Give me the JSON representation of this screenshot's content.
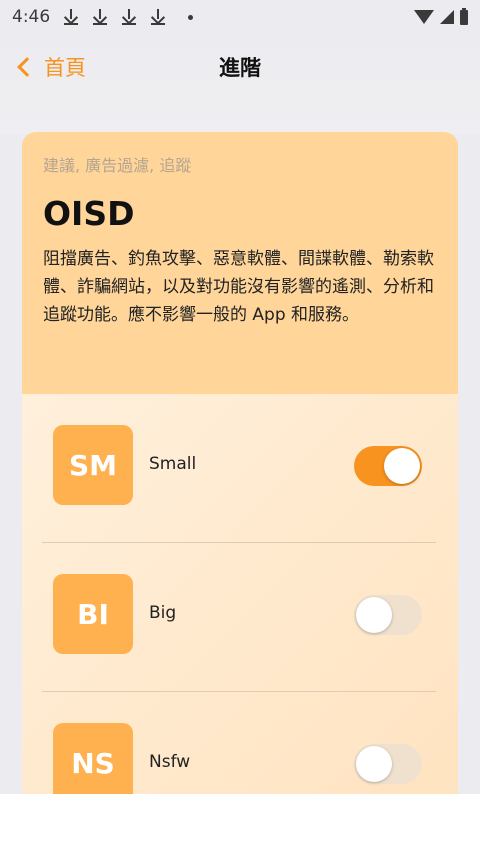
{
  "status_bar": {
    "time": "4:46",
    "icons": [
      "download-icon",
      "download-icon",
      "download-icon",
      "download-icon",
      "dot-icon",
      "wifi-icon",
      "signal-icon",
      "battery-icon"
    ]
  },
  "nav": {
    "back_label": "首頁",
    "title": "進階"
  },
  "card": {
    "subtitle": "建議, 廣告過濾, 追蹤",
    "heading": "OISD",
    "description": "阻擋廣告、釣魚攻擊、惡意軟體、間諜軟體、勒索軟體、詐騙網站，以及對功能沒有影響的遙測、分析和追蹤功能。應不影響一般的 App 和服務。",
    "items": [
      {
        "badge": "SM",
        "label": "Small",
        "enabled": true
      },
      {
        "badge": "BI",
        "label": "Big",
        "enabled": false
      },
      {
        "badge": "NS",
        "label": "Nsfw",
        "enabled": false
      }
    ]
  },
  "colors": {
    "accent": "#f7931e",
    "badge": "#ffb04f",
    "header_bg": "#ffd59a",
    "body_bg": "#ffe8c8"
  }
}
